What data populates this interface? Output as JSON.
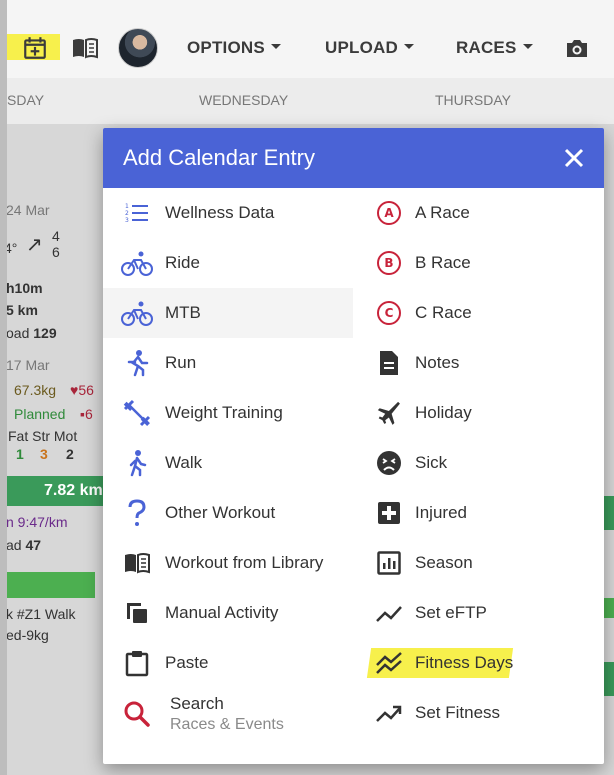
{
  "toolbar": {
    "menus": [
      "OPTIONS",
      "UPLOAD",
      "RACES"
    ],
    "highlight_color": "#f7f04c"
  },
  "day_header": {
    "days": [
      "SDAY",
      "WEDNESDAY",
      "THURSDAY"
    ]
  },
  "calendar_bg": {
    "date1": "24 Mar",
    "arrow_values": [
      "4",
      "6"
    ],
    "left_frag_1": "4°",
    "duration": "h10m",
    "distance": "5 km",
    "load": "oad",
    "load_value": "129",
    "date2": "17 Mar",
    "weight": "67.3kg",
    "hr": "56",
    "planned": "Planned",
    "hr2": "6",
    "stats_header": "Fat Str Mot",
    "stats_values": [
      "1",
      "3",
      "2"
    ],
    "distance_bar": "7.82 km",
    "pace": "n 9:47/km",
    "load2": "ad",
    "load2_value": "47",
    "workout_name": "k #Z1 Walk",
    "workout_sub": "ed-9kg"
  },
  "modal": {
    "title": "Add Calendar Entry",
    "accent_color": "#4a63d6",
    "left_items": [
      {
        "label": "Wellness Data",
        "icon": "list-numbered-icon"
      },
      {
        "label": "Ride",
        "icon": "bike-icon"
      },
      {
        "label": "MTB",
        "icon": "mtb-icon"
      },
      {
        "label": "Run",
        "icon": "run-icon"
      },
      {
        "label": "Weight Training",
        "icon": "dumbbell-icon"
      },
      {
        "label": "Walk",
        "icon": "walk-icon"
      },
      {
        "label": "Other Workout",
        "icon": "question-icon"
      },
      {
        "label": "Workout from Library",
        "icon": "book-icon"
      },
      {
        "label": "Manual Activity",
        "icon": "copy-icon"
      },
      {
        "label": "Paste",
        "icon": "clipboard-icon"
      }
    ],
    "search": {
      "label": "Search",
      "sub": "Races & Events"
    },
    "right_items": [
      {
        "label": "A Race",
        "icon": "a-race-icon",
        "letter": "A"
      },
      {
        "label": "B Race",
        "icon": "b-race-icon",
        "letter": "B"
      },
      {
        "label": "C Race",
        "icon": "c-race-icon",
        "letter": "C"
      },
      {
        "label": "Notes",
        "icon": "notes-icon"
      },
      {
        "label": "Holiday",
        "icon": "airplane-icon"
      },
      {
        "label": "Sick",
        "icon": "sick-face-icon"
      },
      {
        "label": "Injured",
        "icon": "medical-cross-icon"
      },
      {
        "label": "Season",
        "icon": "season-chart-icon"
      },
      {
        "label": "Set eFTP",
        "icon": "trend-line-icon"
      },
      {
        "label": "Fitness Days",
        "icon": "fitness-days-icon"
      },
      {
        "label": "Set Fitness",
        "icon": "trend-up-icon"
      }
    ]
  }
}
